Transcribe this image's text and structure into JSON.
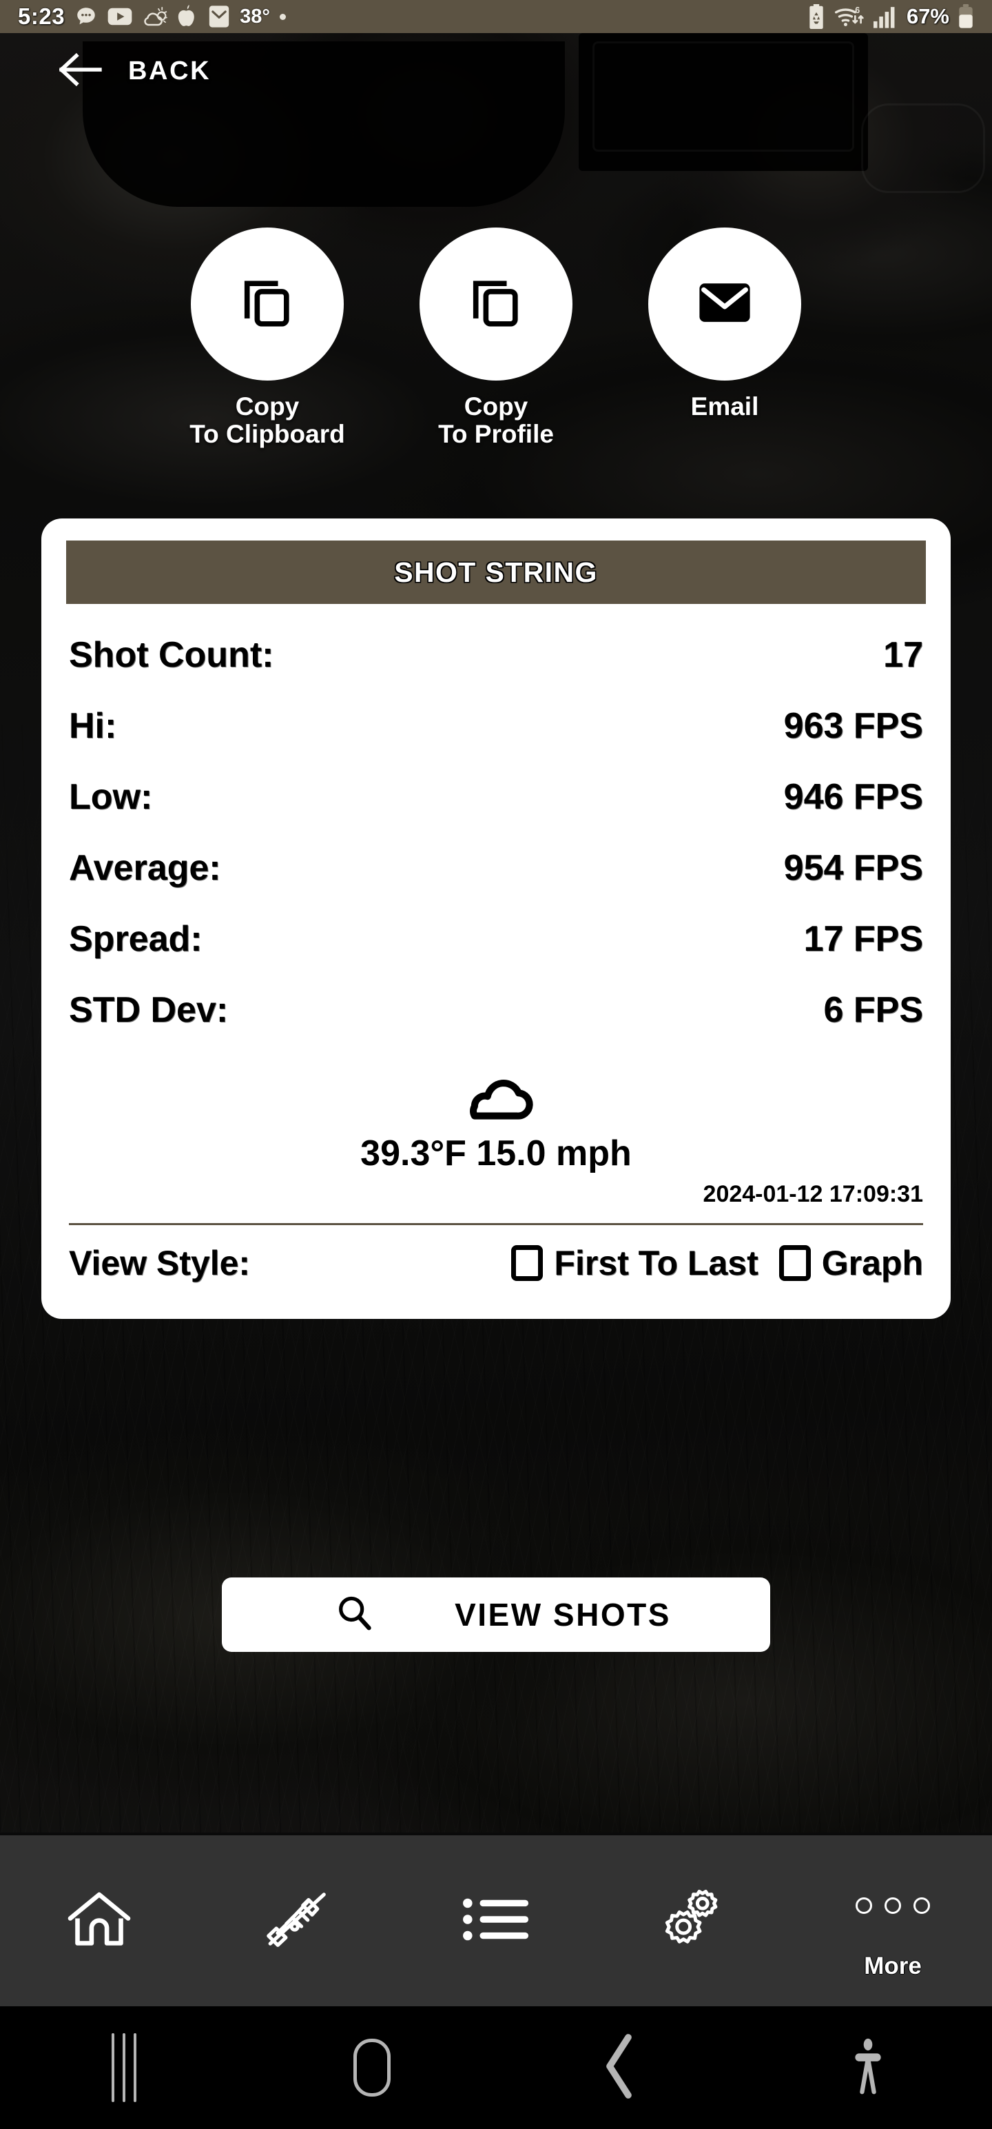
{
  "status_bar": {
    "time": "5:23",
    "temperature": "38°",
    "battery_percent": "67%",
    "icons_left": [
      "messages-icon",
      "youtube-icon",
      "weather-icon",
      "apple-icon",
      "mail-icon"
    ],
    "icons_right": [
      "battery-saver-icon",
      "wifi-6-icon",
      "cellular-signal-icon",
      "battery-icon"
    ],
    "background_color": "#5C5343"
  },
  "header": {
    "back_label": "BACK",
    "back_icon": "arrow-left-icon"
  },
  "actions": [
    {
      "label": "Copy\nTo Clipboard",
      "icon": "copy-icon"
    },
    {
      "label": "Copy\nTo Profile",
      "icon": "copy-icon"
    },
    {
      "label": "Email",
      "icon": "email-icon"
    }
  ],
  "card": {
    "title": "SHOT STRING",
    "title_bar_color": "#5C5343",
    "stats": [
      {
        "label": "Shot Count:",
        "value": "17"
      },
      {
        "label": "Hi:",
        "value": "963 FPS"
      },
      {
        "label": "Low:",
        "value": "946 FPS"
      },
      {
        "label": "Average:",
        "value": "954 FPS"
      },
      {
        "label": "Spread:",
        "value": "17 FPS"
      },
      {
        "label": "STD Dev:",
        "value": "6 FPS"
      }
    ],
    "weather": {
      "icon": "cloud-icon",
      "readout": "39.3°F 15.0 mph"
    },
    "timestamp": "2024-01-12 17:09:31",
    "view_style": {
      "label": "View Style:",
      "options": [
        {
          "label": "First To Last",
          "checked": false
        },
        {
          "label": "Graph",
          "checked": false
        }
      ]
    }
  },
  "view_shots_button": {
    "label": "VIEW SHOTS",
    "icon": "search-icon"
  },
  "app_nav": [
    {
      "name": "home",
      "icon": "home-icon",
      "label": ""
    },
    {
      "name": "rifle",
      "icon": "rifle-icon",
      "label": ""
    },
    {
      "name": "list",
      "icon": "list-icon",
      "label": ""
    },
    {
      "name": "settings",
      "icon": "gears-icon",
      "label": ""
    },
    {
      "name": "more",
      "icon": "three-dots-icon",
      "label": "More"
    }
  ],
  "system_nav": [
    {
      "name": "recents",
      "icon": "recents-icon"
    },
    {
      "name": "home",
      "icon": "home-pill-icon"
    },
    {
      "name": "back",
      "icon": "chevron-left-icon"
    },
    {
      "name": "accessibility",
      "icon": "accessibility-icon"
    }
  ]
}
